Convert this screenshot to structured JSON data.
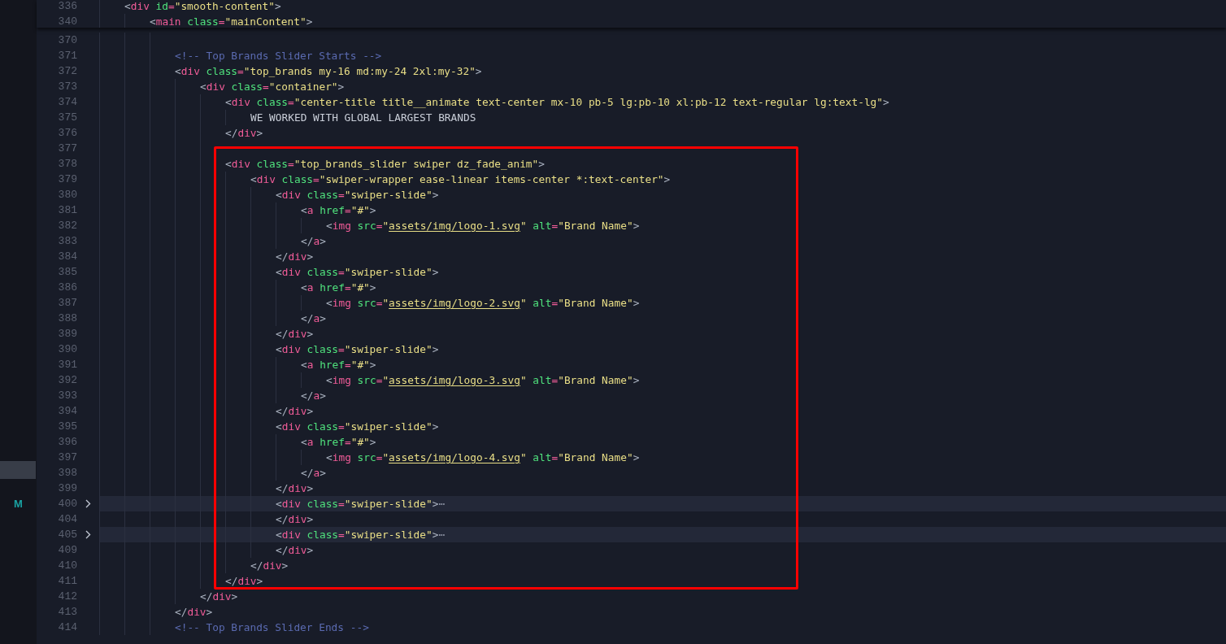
{
  "sticky_lines": [
    {
      "number": "336",
      "text": "<div id=\"smooth-content\">",
      "children": [
        {
          "number": "340",
          "text": "<main class=\"mainContent\">"
        }
      ]
    }
  ],
  "lines": [
    {
      "number": "370",
      "folded": false
    },
    {
      "number": "371",
      "text": "<!-- Top Brands Slider Starts -->",
      "folded": false
    },
    {
      "number": "372",
      "text": "<div class=\"top_brands my-16 md:my-24 2xl:my-32\">",
      "folded": false,
      "children": [
        {
          "number": "373",
          "text": "<div class=\"container\">",
          "folded": false,
          "children": [
            {
              "number": "374",
              "text": "<div class=\"center-title title__animate text-center mx-10 pb-5 lg:pb-10 xl:pb-12 text-regular lg:text-lg\">",
              "folded": false,
              "children": [
                {
                  "number": "375",
                  "text": "WE WORKED WITH GLOBAL LARGEST BRANDS",
                  "folded": false
                }
              ]
            },
            {
              "number": "376",
              "text": "</div>",
              "folded": false
            },
            {
              "number": "377",
              "folded": false
            },
            {
              "number": "378",
              "text": "<div class=\"top_brands_slider swiper dz_fade_anim\">",
              "folded": false,
              "children": [
                {
                  "number": "379",
                  "text": "<div class=\"swiper-wrapper ease-linear items-center *:text-center\">",
                  "folded": false,
                  "children": [
                    {
                      "number": "380",
                      "text": "<div class=\"swiper-slide\">",
                      "folded": false,
                      "children": [
                        {
                          "number": "381",
                          "text": "<a href=\"#\">",
                          "folded": false,
                          "children": [
                            {
                              "number": "382",
                              "text": "<img src=\"assets/img/logo-1.svg\" alt=\"Brand Name\">",
                              "folded": false
                            }
                          ]
                        },
                        {
                          "number": "383",
                          "text": "</a>",
                          "folded": false
                        }
                      ]
                    },
                    {
                      "number": "384",
                      "text": "</div>",
                      "folded": false
                    },
                    {
                      "number": "385",
                      "text": "<div class=\"swiper-slide\">",
                      "folded": false,
                      "children": [
                        {
                          "number": "386",
                          "text": "<a href=\"#\">",
                          "folded": false,
                          "children": [
                            {
                              "number": "387",
                              "text": "<img src=\"assets/img/logo-2.svg\" alt=\"Brand Name\">",
                              "folded": false
                            }
                          ]
                        },
                        {
                          "number": "388",
                          "text": "</a>",
                          "folded": false
                        }
                      ]
                    },
                    {
                      "number": "389",
                      "text": "</div>",
                      "folded": false
                    },
                    {
                      "number": "390",
                      "text": "<div class=\"swiper-slide\">",
                      "folded": false,
                      "children": [
                        {
                          "number": "391",
                          "text": "<a href=\"#\">",
                          "folded": false,
                          "children": [
                            {
                              "number": "392",
                              "text": "<img src=\"assets/img/logo-3.svg\" alt=\"Brand Name\">",
                              "folded": false
                            }
                          ]
                        },
                        {
                          "number": "393",
                          "text": "</a>",
                          "folded": false
                        }
                      ]
                    },
                    {
                      "number": "394",
                      "text": "</div>",
                      "folded": false
                    },
                    {
                      "number": "395",
                      "text": "<div class=\"swiper-slide\">",
                      "folded": false,
                      "children": [
                        {
                          "number": "396",
                          "text": "<a href=\"#\">",
                          "folded": false,
                          "children": [
                            {
                              "number": "397",
                              "text": "<img src=\"assets/img/logo-4.svg\" alt=\"Brand Name\">",
                              "folded": false
                            }
                          ]
                        },
                        {
                          "number": "398",
                          "text": "</a>",
                          "folded": false
                        }
                      ]
                    },
                    {
                      "number": "399",
                      "text": "</div>",
                      "folded": false
                    },
                    {
                      "number": "400",
                      "text": "<div class=\"swiper-slide\">",
                      "fold_marker": "⋯",
                      "folded": true,
                      "badge": "M"
                    },
                    {
                      "number": "404",
                      "text": "</div>",
                      "folded": false
                    },
                    {
                      "number": "405",
                      "text": "<div class=\"swiper-slide\">",
                      "fold_marker": "⋯",
                      "folded": true
                    },
                    {
                      "number": "409",
                      "text": "</div>",
                      "folded": false
                    }
                  ]
                },
                {
                  "number": "410",
                  "text": "</div>",
                  "folded": false
                }
              ]
            },
            {
              "number": "411",
              "text": "</div>",
              "folded": false
            }
          ]
        },
        {
          "number": "412",
          "text": "</div>",
          "folded": false
        }
      ]
    },
    {
      "number": "413",
      "text": "</div>",
      "folded": false
    },
    {
      "number": "414",
      "text": "<!-- Top Brands Slider Ends -->",
      "folded": false
    }
  ]
}
